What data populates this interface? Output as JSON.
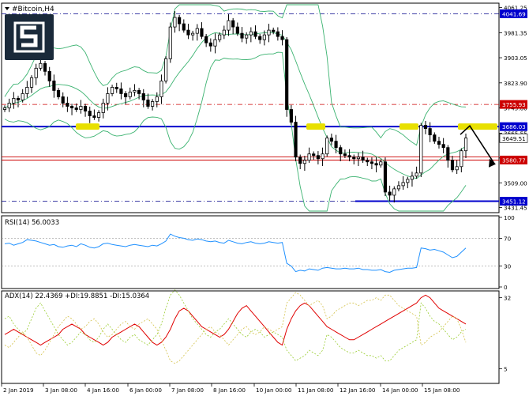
{
  "symbol_label": "#Bitcoin,H4",
  "rsi_label": "RSI(14) 56.0033",
  "adx_label": "ADX(14) 22.4369 +DI:19.8851 -DI:15.0364",
  "colors": {
    "candle": "#000000",
    "bollinger": "#3cb371",
    "support_line": "#0000cd",
    "dashdot_blue": "#00008b",
    "resistance_red": "#cc0000",
    "rsi_line": "#1e90ff",
    "adx_main": "#e00000",
    "plus_di": "#9acd32",
    "minus_di": "#d4c24a",
    "highlight": "#e8e000",
    "tag_blue": "#0000cd",
    "tag_red": "#cc0000",
    "logo_bg": "#1a2a3a"
  },
  "chart_data": [
    {
      "type": "candlestick",
      "title": "#Bitcoin,H4",
      "ylim": [
        3420,
        4070
      ],
      "y_ticks": [
        "4061.25",
        "3981.35",
        "3903.05",
        "3823.90",
        "3745.00",
        "3665.55",
        "3587.35",
        "3509.00",
        "3431.45"
      ],
      "x_ticks": [
        "2 Jan 2019",
        "3 Jan 08:00",
        "4 Jan 16:00",
        "6 Jan 00:00",
        "7 Jan 08:00",
        "8 Jan 16:00",
        "10 Jan 00:00",
        "11 Jan 08:00",
        "12 Jan 16:00",
        "14 Jan 00:00",
        "15 Jan 08:00"
      ],
      "price_tags": [
        {
          "label": "4041.69",
          "value": 4041.69,
          "kind": "dashdot-blue"
        },
        {
          "label": "3755.93",
          "value": 3755.93,
          "kind": "dashdot-red"
        },
        {
          "label": "3686.03",
          "value": 3686.03,
          "kind": "solid-blue"
        },
        {
          "label": "3649.51",
          "value": 3649.51,
          "kind": "current"
        },
        {
          "label": "3580.77",
          "value": 3580.77,
          "kind": "solid-red"
        },
        {
          "label": "3451.12",
          "value": 3451.12,
          "kind": "dashdot-blue"
        }
      ],
      "closes": [
        3745,
        3760,
        3775,
        3770,
        3790,
        3810,
        3840,
        3870,
        3885,
        3860,
        3830,
        3800,
        3780,
        3760,
        3750,
        3745,
        3740,
        3750,
        3735,
        3720,
        3715,
        3730,
        3760,
        3790,
        3810,
        3805,
        3790,
        3780,
        3795,
        3800,
        3790,
        3770,
        3750,
        3765,
        3780,
        3830,
        3900,
        4000,
        4030,
        4010,
        3990,
        3975,
        3980,
        3995,
        3970,
        3950,
        3940,
        3960,
        3975,
        3990,
        4020,
        4000,
        3980,
        3965,
        3975,
        3985,
        3970,
        3960,
        3975,
        3990,
        3985,
        3970,
        3960,
        3740,
        3700,
        3590,
        3570,
        3580,
        3600,
        3595,
        3585,
        3600,
        3650,
        3640,
        3620,
        3600,
        3595,
        3590,
        3585,
        3590,
        3580,
        3575,
        3570,
        3565,
        3575,
        3480,
        3470,
        3490,
        3500,
        3510,
        3520,
        3530,
        3540,
        3690,
        3680,
        3660,
        3640,
        3630,
        3620,
        3580,
        3550,
        3560,
        3610,
        3650
      ]
    },
    {
      "type": "line",
      "title": "RSI(14) 56.0033",
      "ylim": [
        0,
        100
      ],
      "y_ticks": [
        "100",
        "70",
        "30",
        "0"
      ],
      "series": [
        {
          "name": "RSI(14)",
          "values": [
            62,
            63,
            60,
            62,
            64,
            68,
            67,
            66,
            64,
            62,
            60,
            61,
            58,
            57,
            59,
            60,
            58,
            62,
            60,
            57,
            56,
            58,
            62,
            63,
            61,
            60,
            59,
            58,
            60,
            61,
            60,
            59,
            58,
            60,
            59,
            62,
            66,
            76,
            73,
            71,
            70,
            68,
            67,
            69,
            68,
            66,
            65,
            66,
            64,
            63,
            67,
            65,
            63,
            62,
            64,
            65,
            63,
            62,
            63,
            65,
            64,
            63,
            64,
            34,
            30,
            22,
            24,
            23,
            26,
            25,
            24,
            27,
            28,
            27,
            26,
            26,
            27,
            26,
            26,
            27,
            25,
            25,
            24,
            24,
            25,
            22,
            21,
            24,
            25,
            26,
            27,
            27,
            28,
            56,
            55,
            53,
            54,
            52,
            50,
            46,
            42,
            44,
            50,
            56
          ]
        }
      ]
    },
    {
      "type": "line",
      "title": "ADX(14) 22.4369 +DI:19.8851 -DI:15.0364",
      "ylim": [
        0,
        34
      ],
      "y_ticks": [
        "32",
        "5"
      ],
      "series": [
        {
          "name": "ADX(14)",
          "values": [
            18,
            19,
            20,
            19,
            18,
            17,
            16,
            15,
            14,
            15,
            16,
            17,
            18,
            20,
            21,
            22,
            21,
            20,
            18,
            17,
            16,
            15,
            14,
            15,
            17,
            18,
            19,
            20,
            21,
            22,
            21,
            19,
            17,
            15,
            14,
            15,
            17,
            20,
            24,
            27,
            28,
            27,
            25,
            23,
            21,
            20,
            19,
            18,
            17,
            18,
            20,
            23,
            26,
            28,
            29,
            27,
            25,
            23,
            21,
            19,
            17,
            15,
            14,
            20,
            24,
            27,
            29,
            30,
            29,
            27,
            25,
            23,
            21,
            20,
            19,
            18,
            17,
            16,
            16,
            17,
            18,
            19,
            20,
            21,
            22,
            23,
            24,
            25,
            26,
            27,
            28,
            29,
            30,
            32,
            33,
            32,
            30,
            28,
            27,
            26,
            25,
            24,
            23,
            22
          ]
        },
        {
          "name": "+DI",
          "values": [
            24,
            25,
            22,
            20,
            18,
            20,
            24,
            28,
            30,
            27,
            24,
            21,
            18,
            16,
            14,
            15,
            17,
            19,
            18,
            16,
            15,
            17,
            20,
            22,
            20,
            18,
            16,
            15,
            17,
            18,
            16,
            15,
            14,
            16,
            18,
            22,
            28,
            33,
            35,
            33,
            30,
            27,
            24,
            22,
            20,
            18,
            17,
            19,
            20,
            22,
            24,
            22,
            20,
            18,
            17,
            19,
            20,
            19,
            17,
            18,
            19,
            18,
            17,
            12,
            10,
            8,
            9,
            10,
            12,
            11,
            10,
            12,
            18,
            17,
            15,
            13,
            12,
            11,
            11,
            12,
            11,
            10,
            10,
            9,
            10,
            8,
            8,
            10,
            12,
            13,
            14,
            15,
            16,
            30,
            28,
            25,
            23,
            22,
            20,
            18,
            16,
            17,
            19,
            20
          ]
        },
        {
          "name": "-DI",
          "values": [
            14,
            13,
            15,
            17,
            19,
            17,
            14,
            11,
            10,
            12,
            15,
            18,
            21,
            23,
            25,
            24,
            22,
            20,
            21,
            23,
            24,
            22,
            19,
            17,
            18,
            20,
            22,
            23,
            21,
            20,
            22,
            23,
            24,
            22,
            20,
            16,
            12,
            8,
            7,
            8,
            10,
            12,
            14,
            16,
            18,
            20,
            21,
            19,
            18,
            16,
            14,
            16,
            18,
            20,
            21,
            19,
            18,
            19,
            21,
            20,
            19,
            20,
            21,
            30,
            32,
            34,
            33,
            31,
            29,
            30,
            31,
            29,
            24,
            25,
            27,
            28,
            29,
            30,
            30,
            29,
            30,
            31,
            31,
            32,
            31,
            33,
            33,
            31,
            29,
            28,
            27,
            26,
            25,
            14,
            15,
            17,
            18,
            19,
            21,
            23,
            25,
            24,
            20,
            15
          ]
        }
      ]
    }
  ]
}
